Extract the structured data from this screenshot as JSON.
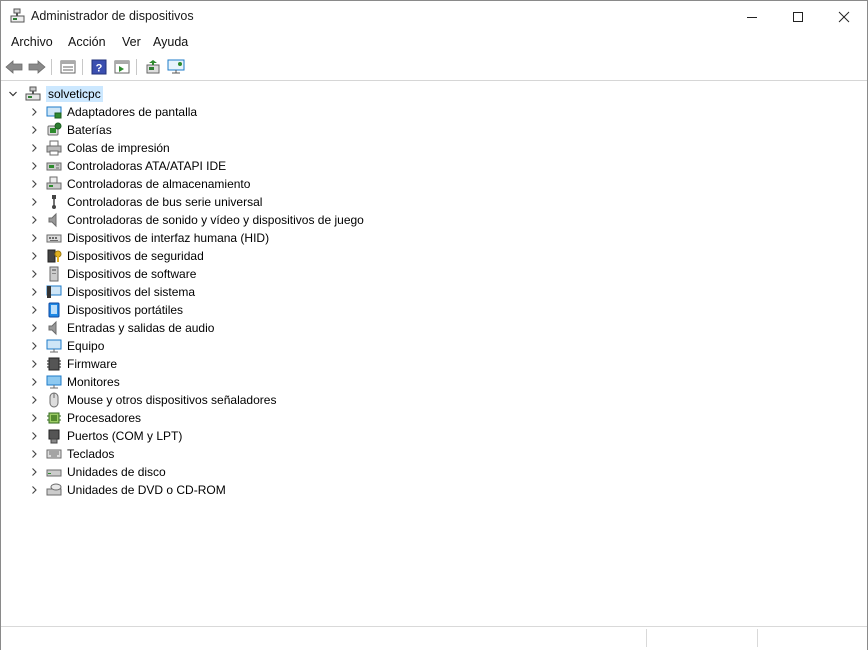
{
  "window": {
    "title": "Administrador de dispositivos",
    "app_icon": "device-manager-icon"
  },
  "menu": {
    "items": [
      "Archivo",
      "Acción",
      "Ver",
      "Ayuda"
    ]
  },
  "toolbar": {
    "buttons": [
      "back-arrow-icon",
      "forward-arrow-icon",
      "properties-icon",
      "help-icon",
      "update-driver-icon",
      "scan-hardware-icon",
      "monitor-icon"
    ]
  },
  "tree": {
    "root": {
      "label": "solveticpc",
      "icon": "computer-icon",
      "expanded": true,
      "selected": true
    },
    "categories": [
      {
        "label": "Adaptadores de pantalla",
        "icon": "display-adapter-icon"
      },
      {
        "label": "Baterías",
        "icon": "battery-icon"
      },
      {
        "label": "Colas de impresión",
        "icon": "printer-icon"
      },
      {
        "label": "Controladoras ATA/ATAPI IDE",
        "icon": "ide-controller-icon"
      },
      {
        "label": "Controladoras de almacenamiento",
        "icon": "storage-controller-icon"
      },
      {
        "label": "Controladoras de bus serie universal",
        "icon": "usb-icon"
      },
      {
        "label": "Controladoras de sonido y vídeo y dispositivos de juego",
        "icon": "speaker-icon"
      },
      {
        "label": "Dispositivos de interfaz humana (HID)",
        "icon": "hid-icon"
      },
      {
        "label": "Dispositivos de seguridad",
        "icon": "security-key-icon"
      },
      {
        "label": "Dispositivos de software",
        "icon": "software-device-icon"
      },
      {
        "label": "Dispositivos del sistema",
        "icon": "system-device-icon"
      },
      {
        "label": "Dispositivos portátiles",
        "icon": "portable-device-icon"
      },
      {
        "label": "Entradas y salidas de audio",
        "icon": "audio-io-icon"
      },
      {
        "label": "Equipo",
        "icon": "computer-monitor-icon"
      },
      {
        "label": "Firmware",
        "icon": "firmware-chip-icon"
      },
      {
        "label": "Monitores",
        "icon": "monitor-icon"
      },
      {
        "label": "Mouse y otros dispositivos señaladores",
        "icon": "mouse-icon"
      },
      {
        "label": "Procesadores",
        "icon": "processor-icon"
      },
      {
        "label": "Puertos (COM y LPT)",
        "icon": "port-icon"
      },
      {
        "label": "Teclados",
        "icon": "keyboard-icon"
      },
      {
        "label": "Unidades de disco",
        "icon": "disk-drive-icon"
      },
      {
        "label": "Unidades de DVD o CD-ROM",
        "icon": "dvd-drive-icon"
      }
    ]
  },
  "colors": {
    "selection": "#cce8ff",
    "icon_blue": "#1e7bc8",
    "icon_gray": "#6b6b6b"
  }
}
